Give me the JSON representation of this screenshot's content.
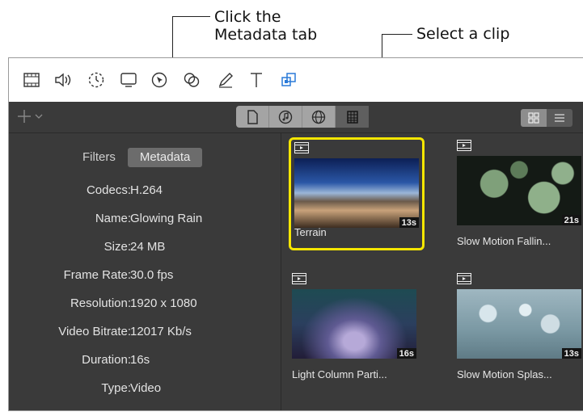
{
  "callouts": {
    "metadata_tab": [
      "Click the",
      "Metadata tab"
    ],
    "select_clip": "Select a clip"
  },
  "toolbar": {
    "icons": [
      "film-icon",
      "audio-icon",
      "transition-icon",
      "display-icon",
      "cursor-icon",
      "effects-icon",
      "pen-icon",
      "text-icon",
      "layers-icon"
    ],
    "accent": "#2a7ad8"
  },
  "browser_bar": {
    "segments": [
      "document-icon",
      "music-icon",
      "globe-icon",
      "grid-icon"
    ],
    "active_segment": 3
  },
  "sidebar": {
    "tabs": [
      "Filters",
      "Metadata"
    ],
    "active_tab": 1,
    "metadata": [
      {
        "key": "Codecs:",
        "value": "H.264"
      },
      {
        "key": "Name:",
        "value": "Glowing Rain"
      },
      {
        "key": "Size:",
        "value": "24 MB"
      },
      {
        "key": "Frame Rate:",
        "value": "30.0 fps"
      },
      {
        "key": "Resolution:",
        "value": "1920 x 1080"
      },
      {
        "key": "Video Bitrate:",
        "value": "12017 Kb/s"
      },
      {
        "key": "Duration:",
        "value": "16s"
      },
      {
        "key": "Type:",
        "value": "Video"
      }
    ]
  },
  "clips": [
    {
      "name": "Terrain",
      "duration": "13s",
      "selected": true
    },
    {
      "name": "Slow Motion Fallin...",
      "duration": "21s",
      "selected": false
    },
    {
      "name": "Light Column Parti...",
      "duration": "16s",
      "selected": false
    },
    {
      "name": "Slow Motion Splas...",
      "duration": "13s",
      "selected": false
    }
  ],
  "colors": {
    "selection": "#f5e600",
    "panel": "#3a3a3a"
  }
}
